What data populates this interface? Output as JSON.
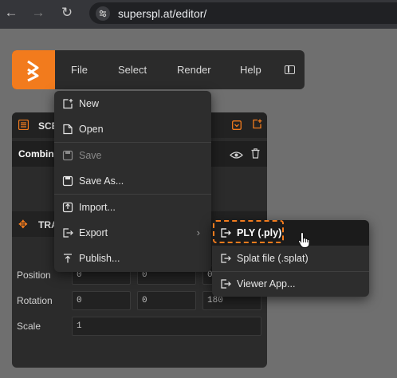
{
  "browser": {
    "url": "superspl.at/editor/",
    "back_icon": "arrow-left-icon",
    "forward_icon": "arrow-right-icon",
    "reload_icon": "reload-icon",
    "site_info_icon": "tune-icon"
  },
  "toolbar": {
    "logo_icon": "supersplat-logo",
    "menus": [
      "File",
      "Select",
      "Render",
      "Help"
    ],
    "collapse_icon": "panel-collapse-icon"
  },
  "scene_panel": {
    "title": "SCENE",
    "title_visible": "SCE",
    "combined_label": "Combined",
    "combined_visible": "Combine"
  },
  "transform_panel": {
    "title": "TRANSFORM",
    "title_visible": "TRA",
    "rows": [
      {
        "label": "Position",
        "values": [
          "0",
          "0",
          "0"
        ]
      },
      {
        "label": "Rotation",
        "values": [
          "0",
          "0",
          "180"
        ]
      },
      {
        "label": "Scale",
        "values": [
          "1"
        ]
      }
    ]
  },
  "file_menu": {
    "items": [
      {
        "label": "New",
        "icon": "new-file-icon",
        "disabled": false
      },
      {
        "label": "Open",
        "icon": "open-file-icon",
        "disabled": false
      },
      {
        "label": "Save",
        "icon": "save-icon",
        "disabled": true
      },
      {
        "label": "Save As...",
        "icon": "save-as-icon",
        "disabled": false
      },
      {
        "label": "Import...",
        "icon": "import-icon",
        "disabled": false
      },
      {
        "label": "Export",
        "icon": "export-icon",
        "disabled": false,
        "has_submenu": true
      },
      {
        "label": "Publish...",
        "icon": "publish-icon",
        "disabled": false
      }
    ]
  },
  "export_menu": {
    "items": [
      {
        "label": "PLY (.ply)",
        "icon": "export-icon",
        "hovered": true
      },
      {
        "label": "Splat file (.splat)",
        "icon": "export-icon",
        "hovered": false
      },
      {
        "label": "Viewer App...",
        "icon": "export-icon",
        "hovered": false
      }
    ]
  },
  "colors": {
    "accent": "#f27b1d",
    "background": "#6f6f6f",
    "panel": "#2b2b2b",
    "menu": "#2d2d2d"
  }
}
